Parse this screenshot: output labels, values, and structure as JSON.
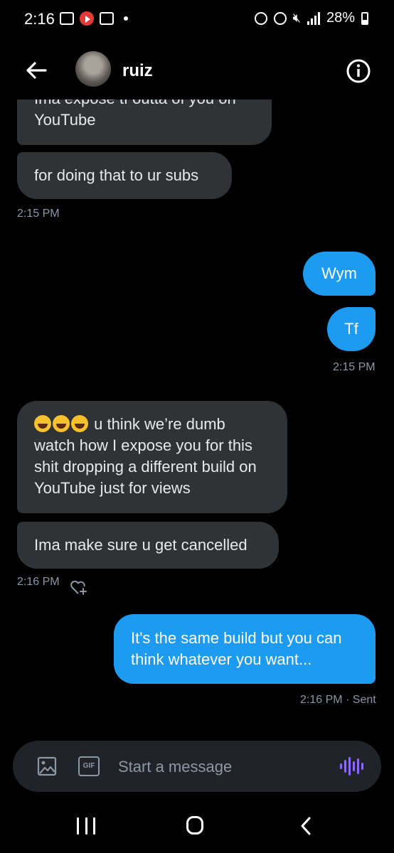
{
  "status_bar": {
    "time": "2:16",
    "battery": "28%"
  },
  "header": {
    "contact_name": "ruiz",
    "back_icon": "arrow-left-icon",
    "info_icon": "info-icon"
  },
  "messages": [
    {
      "from": "them",
      "text": "Ima expose tf outta of you on YouTube"
    },
    {
      "from": "them",
      "text": "for doing that to ur subs"
    },
    {
      "timestamp": "2:15 PM"
    },
    {
      "from": "me",
      "text": "Wym"
    },
    {
      "from": "me",
      "text": "Tf"
    },
    {
      "timestamp": "2:15 PM"
    },
    {
      "from": "them",
      "emoji": "😂😂😂",
      "text": " u think we’re dumb watch how I expose you for this shit dropping a different build on YouTube just for views"
    },
    {
      "from": "them",
      "text": "Ima make sure u get cancelled"
    },
    {
      "timestamp": "2:16 PM"
    },
    {
      "from": "me",
      "text": "It's the same build but you can think whatever you want..."
    },
    {
      "timestamp": "2:16 PM · Sent"
    }
  ],
  "composer": {
    "placeholder": "Start a message",
    "gif_label": "GIF"
  },
  "colors": {
    "sent_bubble": "#1d9bf0",
    "received_bubble": "#2f3336",
    "voice_icon": "#8a6cf7"
  }
}
